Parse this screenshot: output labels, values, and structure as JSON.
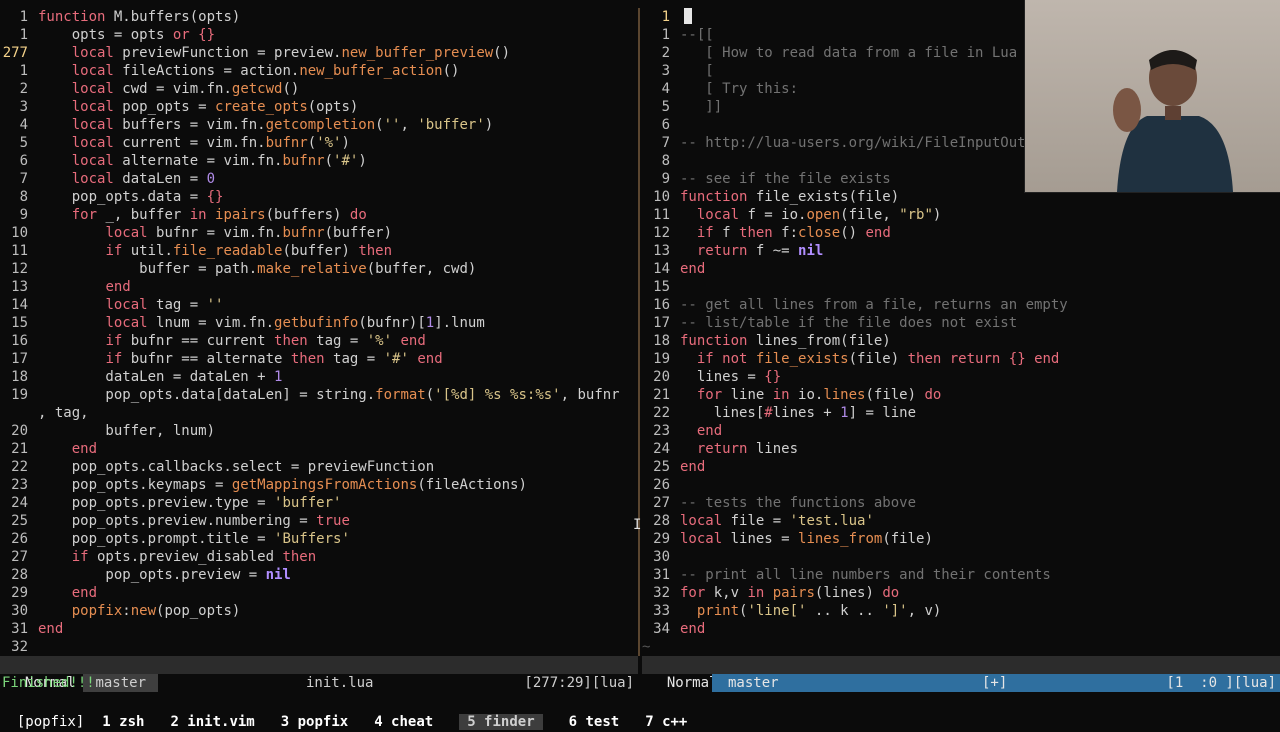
{
  "left_pane": {
    "lines": [
      {
        "n": "1",
        "h": "<span class=\"kw\">function</span> M.buffers(opts)"
      },
      {
        "n": "1",
        "h": "    opts = opts <span class=\"kw\">or</span> <span class=\"kw\">{}</span>"
      },
      {
        "n": "277",
        "cur": true,
        "h": "    <span class=\"kw\">local</span> previewFunction = preview.<span class=\"fn\">new_buffer_preview</span>()"
      },
      {
        "n": "1",
        "h": "    <span class=\"kw\">local</span> fileActions = action.<span class=\"fn\">new_buffer_action</span>()"
      },
      {
        "n": "2",
        "h": "    <span class=\"kw\">local</span> cwd = vim.fn.<span class=\"fn\">getcwd</span>()"
      },
      {
        "n": "3",
        "h": "    <span class=\"kw\">local</span> pop_opts = <span class=\"fn\">create_opts</span>(opts)"
      },
      {
        "n": "4",
        "h": "    <span class=\"kw\">local</span> buffers = vim.fn.<span class=\"fn\">getcompletion</span>(<span class=\"str\">''</span>, <span class=\"str\">'buffer'</span>)"
      },
      {
        "n": "5",
        "h": "    <span class=\"kw\">local</span> current = vim.fn.<span class=\"fn\">bufnr</span>(<span class=\"str\">'%'</span>)"
      },
      {
        "n": "6",
        "h": "    <span class=\"kw\">local</span> alternate = vim.fn.<span class=\"fn\">bufnr</span>(<span class=\"str\">'#'</span>)"
      },
      {
        "n": "7",
        "h": "    <span class=\"kw\">local</span> dataLen = <span class=\"num2\">0</span>"
      },
      {
        "n": "8",
        "h": "    pop_opts.data = <span class=\"kw\">{}</span>"
      },
      {
        "n": "9",
        "h": "    <span class=\"kw\">for</span> _, buffer <span class=\"kw\">in</span> <span class=\"fn\">ipairs</span>(buffers) <span class=\"kw\">do</span>"
      },
      {
        "n": "10",
        "h": "        <span class=\"kw\">local</span> bufnr = vim.fn.<span class=\"fn\">bufnr</span>(buffer)"
      },
      {
        "n": "11",
        "h": "        <span class=\"kw\">if</span> util.<span class=\"fn\">file_readable</span>(buffer) <span class=\"kw\">then</span>"
      },
      {
        "n": "12",
        "h": "            buffer = path.<span class=\"fn\">make_relative</span>(buffer, cwd)"
      },
      {
        "n": "13",
        "h": "        <span class=\"kw\">end</span>"
      },
      {
        "n": "14",
        "h": "        <span class=\"kw\">local</span> tag = <span class=\"str\">''</span>"
      },
      {
        "n": "15",
        "h": "        <span class=\"kw\">local</span> lnum = vim.fn.<span class=\"fn\">getbufinfo</span>(bufnr)[<span class=\"num2\">1</span>].lnum"
      },
      {
        "n": "16",
        "h": "        <span class=\"kw\">if</span> bufnr == current <span class=\"kw\">then</span> tag = <span class=\"str\">'%'</span> <span class=\"kw\">end</span>"
      },
      {
        "n": "17",
        "h": "        <span class=\"kw\">if</span> bufnr == alternate <span class=\"kw\">then</span> tag = <span class=\"str\">'#'</span> <span class=\"kw\">end</span>"
      },
      {
        "n": "18",
        "h": "        dataLen = dataLen + <span class=\"num2\">1</span>"
      },
      {
        "n": "19",
        "h": "        pop_opts.data[dataLen] = string.<span class=\"fn\">format</span>(<span class=\"str\">'[%d] %s %s:%s'</span>, bufnr"
      },
      {
        "n": "",
        "cont": true,
        "h": ", tag,"
      },
      {
        "n": "20",
        "h": "        buffer, lnum)"
      },
      {
        "n": "21",
        "h": "    <span class=\"kw\">end</span>"
      },
      {
        "n": "22",
        "h": "    pop_opts.callbacks.select = previewFunction"
      },
      {
        "n": "23",
        "h": "    pop_opts.keymaps = <span class=\"fn\">getMappingsFromActions</span>(fileActions)"
      },
      {
        "n": "24",
        "h": "    pop_opts.preview.type = <span class=\"str\">'buffer'</span>"
      },
      {
        "n": "25",
        "h": "    pop_opts.preview.numbering = <span class=\"kw\">true</span>"
      },
      {
        "n": "26",
        "h": "    pop_opts.prompt.title = <span class=\"str\">'Buffers'</span>"
      },
      {
        "n": "27",
        "h": "    <span class=\"kw\">if</span> opts.preview_disabled <span class=\"kw\">then</span>"
      },
      {
        "n": "28",
        "h": "        pop_opts.preview = <span class=\"nil\">nil</span>"
      },
      {
        "n": "29",
        "h": "    <span class=\"kw\">end</span>"
      },
      {
        "n": "30",
        "h": "    <span class=\"fn\">popfix</span>:<span class=\"fn\">new</span>(pop_opts)"
      },
      {
        "n": "31",
        "h": "<span class=\"kw\">end</span>"
      },
      {
        "n": "32",
        "h": ""
      }
    ]
  },
  "right_pane": {
    "lines": [
      {
        "n": "1",
        "cur": true,
        "cursor": true,
        "h": ""
      },
      {
        "n": "1",
        "h": "<span class=\"cm\">--[[</span>"
      },
      {
        "n": "2",
        "h": "<span class=\"cm\">   [ How to read data from a file in Lua</span>"
      },
      {
        "n": "3",
        "h": "<span class=\"cm\">   [</span>"
      },
      {
        "n": "4",
        "h": "<span class=\"cm\">   [ Try this:</span>"
      },
      {
        "n": "5",
        "h": "<span class=\"cm\">   ]]</span>"
      },
      {
        "n": "6",
        "h": ""
      },
      {
        "n": "7",
        "h": "<span class=\"cm\">-- http://lua-users.org/wiki/FileInputOutput</span>"
      },
      {
        "n": "8",
        "h": ""
      },
      {
        "n": "9",
        "h": "<span class=\"cm\">-- see if the file exists</span>"
      },
      {
        "n": "10",
        "h": "<span class=\"kw\">function</span> file_exists(file)"
      },
      {
        "n": "11",
        "h": "  <span class=\"kw\">local</span> f = io.<span class=\"fn\">open</span>(file, <span class=\"str\">\"rb\"</span>)"
      },
      {
        "n": "12",
        "h": "  <span class=\"kw\">if</span> f <span class=\"kw\">then</span> f:<span class=\"fn\">close</span>() <span class=\"kw\">end</span>"
      },
      {
        "n": "13",
        "h": "  <span class=\"kw\">return</span> f ~= <span class=\"nil\">nil</span>"
      },
      {
        "n": "14",
        "h": "<span class=\"kw\">end</span>"
      },
      {
        "n": "15",
        "h": ""
      },
      {
        "n": "16",
        "h": "<span class=\"cm\">-- get all lines from a file, returns an empty</span>"
      },
      {
        "n": "17",
        "h": "<span class=\"cm\">-- list/table if the file does not exist</span>"
      },
      {
        "n": "18",
        "h": "<span class=\"kw\">function</span> lines_from(file)"
      },
      {
        "n": "19",
        "h": "  <span class=\"kw\">if not</span> <span class=\"fn\">file_exists</span>(file) <span class=\"kw\">then return</span> <span class=\"kw\">{}</span> <span class=\"kw\">end</span>"
      },
      {
        "n": "20",
        "h": "  lines = <span class=\"kw\">{}</span>"
      },
      {
        "n": "21",
        "h": "  <span class=\"kw\">for</span> line <span class=\"kw\">in</span> io.<span class=\"fn\">lines</span>(file) <span class=\"kw\">do</span>"
      },
      {
        "n": "22",
        "h": "    lines[<span class=\"kw\">#</span>lines + <span class=\"num2\">1</span>] = line"
      },
      {
        "n": "23",
        "h": "  <span class=\"kw\">end</span>"
      },
      {
        "n": "24",
        "h": "  <span class=\"kw\">return</span> lines"
      },
      {
        "n": "25",
        "h": "<span class=\"kw\">end</span>"
      },
      {
        "n": "26",
        "h": ""
      },
      {
        "n": "27",
        "h": "<span class=\"cm\">-- tests the functions above</span>"
      },
      {
        "n": "28",
        "h": "<span class=\"kw\">local</span> file = <span class=\"str\">'test.lua'</span>"
      },
      {
        "n": "29",
        "h": "<span class=\"kw\">local</span> lines = <span class=\"fn\">lines_from</span>(file)"
      },
      {
        "n": "30",
        "h": ""
      },
      {
        "n": "31",
        "h": "<span class=\"cm\">-- print all line numbers and their contents</span>"
      },
      {
        "n": "32",
        "h": "<span class=\"kw\">for</span> k,v <span class=\"kw\">in</span> <span class=\"fn\">pairs</span>(lines) <span class=\"kw\">do</span>"
      },
      {
        "n": "33",
        "h": "  <span class=\"fn\">print</span>(<span class=\"str\">'line['</span> .. k .. <span class=\"str\">']'</span>, v)"
      },
      {
        "n": "34",
        "h": "<span class=\"kw\">end</span>"
      }
    ],
    "tilde": "~"
  },
  "statusline_left": {
    "mode": "Normal",
    "branch": "master",
    "file": "init.lua",
    "position": "[277:29][lua]"
  },
  "statusline_right": {
    "mode": "Normal",
    "branch": "master",
    "modified": "[+]",
    "position": "[1  :0 ][lua]"
  },
  "cmdline": "Finished!!!",
  "tmux": {
    "session": "[popfix]",
    "windows": [
      "1 zsh",
      "2 init.vim",
      "3 popfix",
      "4 cheat",
      "5 finder",
      "6 test",
      "7 c++"
    ],
    "active_index": 4
  },
  "colors": {
    "keyword": "#e86c7c",
    "function": "#e68e52",
    "string": "#d9c489",
    "comment": "#727272",
    "number": "#b08be8",
    "cmd": "#7bd67b",
    "statusline_right_accent": "#2f6f9f"
  }
}
